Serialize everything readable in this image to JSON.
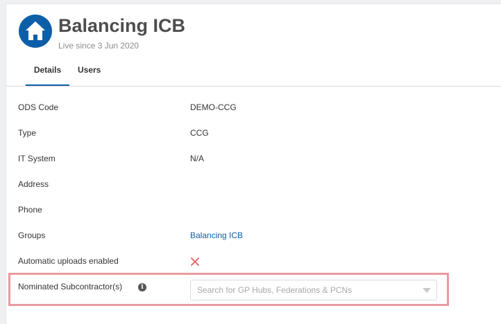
{
  "header": {
    "avatar_icon": "house-icon",
    "title": "Balancing ICB",
    "subtitle": "Live since 3 Jun 2020"
  },
  "tabs": [
    {
      "label": "Details",
      "active": true
    },
    {
      "label": "Users",
      "active": false
    }
  ],
  "details": {
    "ods_code": {
      "label": "ODS Code",
      "value": "DEMO-CCG"
    },
    "type": {
      "label": "Type",
      "value": "CCG"
    },
    "it_system": {
      "label": "IT System",
      "value": "N/A"
    },
    "address": {
      "label": "Address",
      "value": ""
    },
    "phone": {
      "label": "Phone",
      "value": ""
    },
    "groups": {
      "label": "Groups",
      "value": "Balancing ICB"
    },
    "automatic_uploads": {
      "label": "Automatic uploads enabled",
      "value_icon": "cross-icon",
      "enabled": false
    },
    "nominated_subcontractors": {
      "label": "Nominated Subcontractor(s)",
      "info_icon": "info-icon",
      "info_glyph": "i",
      "placeholder": "Search for GP Hubs, Federations & PCNs",
      "value": ""
    }
  },
  "colors": {
    "brand": "#0d5ea8",
    "link": "#0d5ea8",
    "cross": "#e06060",
    "highlight_border": "#e89aa0"
  }
}
